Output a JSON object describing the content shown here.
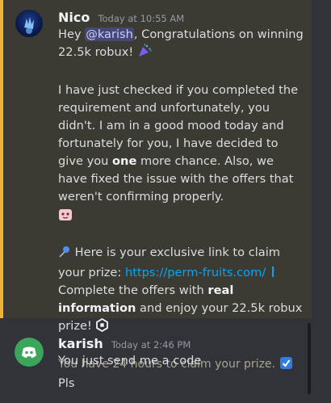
{
  "messages": [
    {
      "author": "Nico",
      "timestamp": "Today at 10:55 AM",
      "greeting_prefix": "Hey ",
      "mention": "@karish",
      "greeting_suffix": ", Congratulations on winning 22.5k robux!",
      "para2_a": "I have just checked if you completed the requirement and unfortunately, you didn't. I am in a good mood today and fortunately for you, I have decided to give you ",
      "para2_bold": "one",
      "para2_b": " more chance. Also, we have fixed the issue with the offers that weren't confirming properly.",
      "para3_a": " Here is your exclusive link to claim your prize: ",
      "link": "https://perm-fruits.com/",
      "para3_b": "Complete the offers with ",
      "para3_bold": "real information",
      "para3_c": " and enjoy your 22.5k robux prize!",
      "footer": "You have 24 hours to claim your prize."
    },
    {
      "author": "karish",
      "timestamp": "Today at 2:46 PM",
      "lines": [
        "You just send me a code",
        "Pls"
      ]
    }
  ],
  "icons": {
    "party": "party-popper-icon",
    "sticker": "pink-creature-sticker-icon",
    "pin": "pushpin-icon",
    "robux": "robux-icon",
    "check": "check-mark-button-icon",
    "discord": "discord-logo-icon"
  },
  "colors": {
    "background": "#313338",
    "mention_highlight": "#3b3a33",
    "mention_bar": "#f0b232",
    "link": "#00a8fc",
    "karish_avatar": "#3ba55c"
  }
}
